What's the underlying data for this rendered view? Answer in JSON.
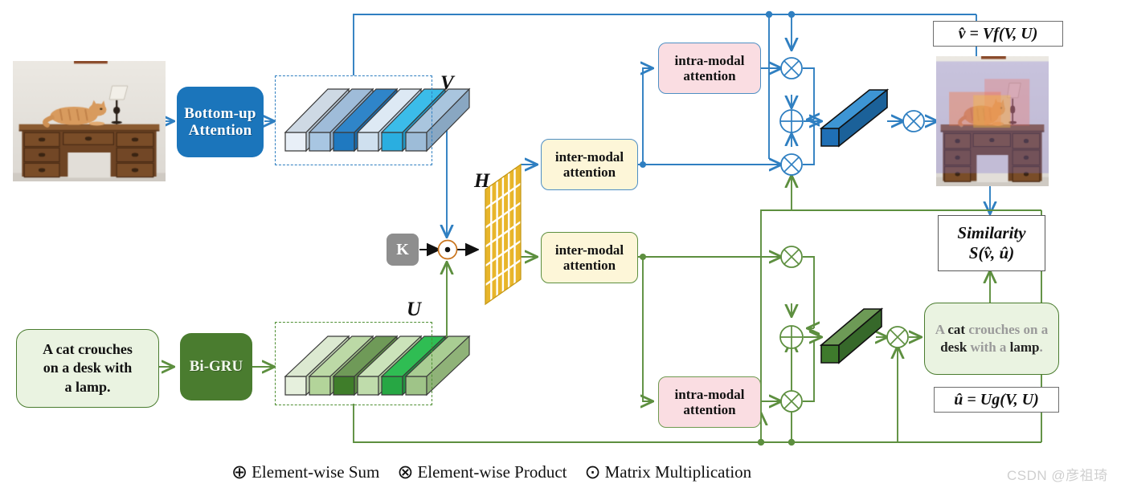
{
  "figure": {
    "title": "Cross-modal attention network diagram",
    "watermark": "CSDN @彦祖琦"
  },
  "colors": {
    "blue_stream": "#2f7fc1",
    "green_stream": "#5d8f3f",
    "blue_box_fill": "#1b75bb",
    "green_box_fill": "#4a7c2f",
    "inter_attn_fill": "#fdf6d8",
    "intra_attn_fill": "#fadde2",
    "matrix_fill": "#e8b52a",
    "caption_fill": "#eaf3e1",
    "k_node_fill": "#8e8e8e"
  },
  "visual_stream": {
    "encoder_label": "Bottom-up\nAttention",
    "encoder_label_line1": "Bottom-up",
    "encoder_label_line2": "Attention",
    "feature_label": "V",
    "inter_attention_label_line1": "inter-modal",
    "inter_attention_label_line2": "attention",
    "intra_attention_label_line1": "intra-modal",
    "intra_attention_label_line2": "attention",
    "output_formula": "v̂ = Vf(V, U)",
    "bar_colors": [
      "#e8eff7",
      "#a8c6e2",
      "#1f79c0",
      "#cfe0ef",
      "#2aaee0",
      "#9dbcd8"
    ]
  },
  "text_stream": {
    "input_caption": "A cat crouches on a desk with a lamp.",
    "input_caption_line1": "A cat crouches",
    "input_caption_line2": "on a desk with",
    "input_caption_line3": "a lamp.",
    "encoder_label": "Bi-GRU",
    "feature_label": "U",
    "inter_attention_label_line1": "inter-modal",
    "inter_attention_label_line2": "attention",
    "intra_attention_label_line1": "intra-modal",
    "intra_attention_label_line2": "attention",
    "output_formula": "û = Ug(V, U)",
    "attended_caption_words": [
      "A ",
      "cat",
      " crouches ",
      "on a ",
      "desk",
      " with ",
      "a ",
      "lamp",
      "."
    ],
    "bar_colors": [
      "#e6f0dd",
      "#b3d49a",
      "#3f7d2a",
      "#bfdcab",
      "#27a744",
      "#9fc488"
    ]
  },
  "fusion": {
    "matrix_label": "H",
    "k_node_label": "K",
    "matrix_rows": 6,
    "matrix_cols": 6
  },
  "similarity": {
    "line1": "Similarity",
    "line2": "S(v̂, û)"
  },
  "legend": {
    "items": [
      {
        "symbol": "⊕",
        "label": "Element-wise Sum"
      },
      {
        "symbol": "⊗",
        "label": "Element-wise Product"
      },
      {
        "symbol": "⊙",
        "label": "Matrix Multiplication"
      }
    ],
    "sum_symbol": "⊕",
    "sum_label": "Element-wise Sum",
    "product_symbol": "⊗",
    "product_label": "Element-wise Product",
    "matmul_symbol": "⊙",
    "matmul_label": "Matrix Multiplication"
  }
}
